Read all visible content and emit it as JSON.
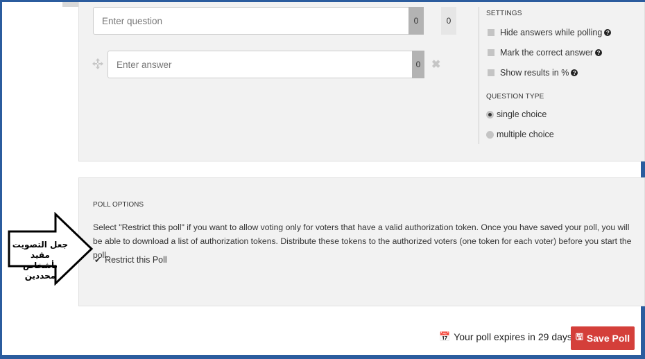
{
  "question": {
    "placeholder": "Enter question",
    "char_count": "0",
    "points": "0"
  },
  "answer": {
    "placeholder": "Enter answer",
    "char_count": "0"
  },
  "settings": {
    "title": "SETTINGS",
    "options": [
      {
        "label": "Hide answers while polling",
        "checked": false
      },
      {
        "label": "Mark the correct answer",
        "checked": false
      },
      {
        "label": "Show results in %",
        "checked": false
      }
    ]
  },
  "question_type": {
    "title": "QUESTION TYPE",
    "options": [
      {
        "label": "single choice",
        "selected": true
      },
      {
        "label": "multiple choice",
        "selected": false
      }
    ]
  },
  "poll_options": {
    "title": "POLL OPTIONS",
    "description": "Select \"Restrict this poll\" if you want to allow voting only for voters that have a valid authorization token. Once you have saved your poll, you will be able to download a list of authorization tokens. Distribute these tokens to the authorized voters (one token for each voter) before you start the poll.",
    "restrict_label": "Restrict this Poll",
    "restrict_checked": true
  },
  "annotation": {
    "line1": "جعل التصويت مقيد",
    "line2": "بأشخاص محددين"
  },
  "footer": {
    "expires_text": "Your poll expires in 29 days",
    "save_label": "Save Poll"
  },
  "colors": {
    "frame": "#2b5c9e",
    "save_button": "#d43f3a",
    "panel_bg": "#f2f2f2"
  }
}
